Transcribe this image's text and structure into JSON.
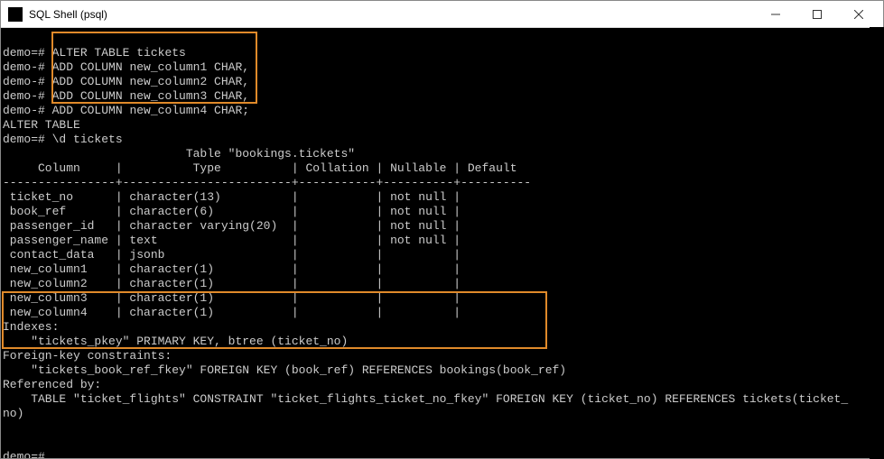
{
  "window": {
    "title": "SQL Shell (psql)"
  },
  "terminal": {
    "prompt_main": "demo=#",
    "prompt_cont": "demo-#",
    "cmd": {
      "l1": "ALTER TABLE tickets",
      "l2": "ADD COLUMN new_column1 CHAR,",
      "l3": "ADD COLUMN new_column2 CHAR,",
      "l4": "ADD COLUMN new_column3 CHAR,",
      "l5": "ADD COLUMN new_column4 CHAR;"
    },
    "response_alter": "ALTER TABLE",
    "cmd_describe": "\\d tickets",
    "table_title": "Table \"bookings.tickets\"",
    "headers": {
      "column": "Column",
      "type": "Type",
      "collation": "Collation",
      "nullable": "Nullable",
      "default": "Default"
    },
    "rows": [
      {
        "col": "ticket_no",
        "type": "character(13)",
        "collation": "",
        "nullable": "not null",
        "default": ""
      },
      {
        "col": "book_ref",
        "type": "character(6)",
        "collation": "",
        "nullable": "not null",
        "default": ""
      },
      {
        "col": "passenger_id",
        "type": "character varying(20)",
        "collation": "",
        "nullable": "not null",
        "default": ""
      },
      {
        "col": "passenger_name",
        "type": "text",
        "collation": "",
        "nullable": "not null",
        "default": ""
      },
      {
        "col": "contact_data",
        "type": "jsonb",
        "collation": "",
        "nullable": "",
        "default": ""
      },
      {
        "col": "new_column1",
        "type": "character(1)",
        "collation": "",
        "nullable": "",
        "default": ""
      },
      {
        "col": "new_column2",
        "type": "character(1)",
        "collation": "",
        "nullable": "",
        "default": ""
      },
      {
        "col": "new_column3",
        "type": "character(1)",
        "collation": "",
        "nullable": "",
        "default": ""
      },
      {
        "col": "new_column4",
        "type": "character(1)",
        "collation": "",
        "nullable": "",
        "default": ""
      }
    ],
    "footer": {
      "indexes_label": "Indexes:",
      "index_line": "    \"tickets_pkey\" PRIMARY KEY, btree (ticket_no)",
      "fk_label": "Foreign-key constraints:",
      "fk_line": "    \"tickets_book_ref_fkey\" FOREIGN KEY (book_ref) REFERENCES bookings(book_ref)",
      "ref_label": "Referenced by:",
      "ref_line1": "    TABLE \"ticket_flights\" CONSTRAINT \"ticket_flights_ticket_no_fkey\" FOREIGN KEY (ticket_no) REFERENCES tickets(ticket_",
      "ref_line2": "no)"
    }
  }
}
